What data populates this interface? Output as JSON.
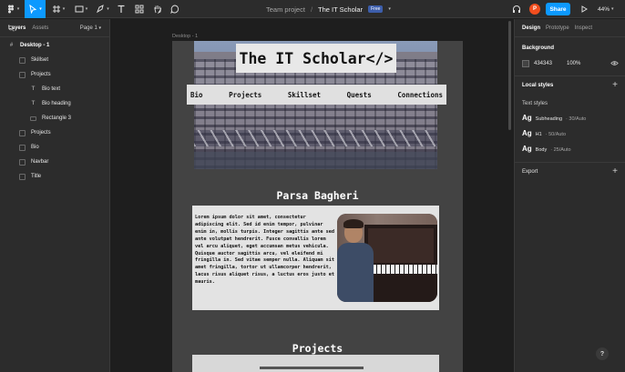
{
  "toolbar": {
    "breadcrumb_team": "Team project",
    "breadcrumb_sep": "/",
    "file_name": "The IT Scholar",
    "plan_badge": "Free",
    "share_label": "Share",
    "avatar_initial": "P",
    "zoom": "44%",
    "active_tool": "move-tool",
    "icons": [
      "figma-menu-icon",
      "move-tool-icon",
      "frame-tool-icon",
      "shape-tool-icon",
      "pen-tool-icon",
      "text-tool-icon",
      "resources-icon",
      "hand-tool-icon",
      "comment-icon",
      "headphones-icon",
      "present-icon"
    ]
  },
  "left_panel": {
    "tab_layers": "Layers",
    "tab_assets": "Assets",
    "page_name": "Page 1",
    "layers": [
      {
        "label": "Desktop - 1",
        "icon": "frame-icon"
      },
      {
        "label": "Skillset",
        "icon": "frame-icon"
      },
      {
        "label": "Projects",
        "icon": "frame-icon"
      },
      {
        "label": "Bio text",
        "icon": "text-icon"
      },
      {
        "label": "Bio heading",
        "icon": "text-icon"
      },
      {
        "label": "Rectangle 3",
        "icon": "rectangle-icon"
      },
      {
        "label": "Projects",
        "icon": "frame-icon"
      },
      {
        "label": "Bio",
        "icon": "frame-icon"
      },
      {
        "label": "Navbar",
        "icon": "frame-icon"
      },
      {
        "label": "Title",
        "icon": "frame-icon"
      }
    ]
  },
  "canvas": {
    "frame_label": "Desktop - 1",
    "site_title": "The IT Scholar</>",
    "nav_items": [
      "Bio",
      "Projects",
      "Skillset",
      "Quests",
      "Connections"
    ],
    "person_name": "Parsa Bagheri",
    "bio_text": "Lorem ipsum dolor sit amet, consectetur adipiscing elit. Sed id enim tempor, pulvinar enim in, mollis turpis. Integer sagittis ante sed ante volutpat hendrerit. Fusce convallis lorem vel arcu aliquet, eget accumsan metus vehicula. Quisque auctor sagittis arcu, vel eleifend mi fringilla in. Sed vitae semper nulla. Aliquam sit amet fringilla, tortor ut ullamcorper hendrerit, lacus risus aliquet risus, a luctus eros justo et mauris.",
    "projects_heading": "Projects"
  },
  "right_panel": {
    "tab_design": "Design",
    "tab_prototype": "Prototype",
    "tab_inspect": "Inspect",
    "background_heading": "Background",
    "background_hex": "434343",
    "background_opacity": "100%",
    "background_color": "#434343",
    "local_styles_heading": "Local styles",
    "text_styles_heading": "Text styles",
    "text_styles": [
      {
        "ag": "Ag",
        "name": "Subheading",
        "meta": "· 30/Auto"
      },
      {
        "ag": "Ag",
        "name": "H1",
        "meta": "· 50/Auto"
      },
      {
        "ag": "Ag",
        "name": "Body",
        "meta": "· 25/Auto"
      }
    ],
    "export_heading": "Export"
  },
  "help_label": "?"
}
